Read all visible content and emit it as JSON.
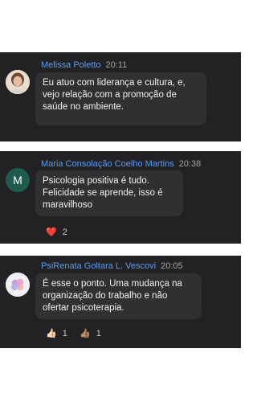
{
  "messages": [
    {
      "sender": "Melissa Poletto",
      "time": "20:11",
      "text": "Eu atuo com liderança e cultura, e,\nvejo relação com a promoção de\nsaúde no ambiente."
    },
    {
      "sender": "Maria Consolação Coelho Martins",
      "time": "20:38",
      "avatar_letter": "M",
      "text": "Psicologia positiva é tudo.\nFelicidade se aprende, isso é\nmaravilhoso",
      "reaction": {
        "emoji": "❤️",
        "count": "2"
      }
    },
    {
      "sender": "PsiRenata Goltara L. Vescovi",
      "time": "20:05",
      "text": "É esse o ponto. Uma mudança na\norganização do trabalho e não\nofertar psicoterapia.",
      "reactions": [
        {
          "emoji": "👍🏻",
          "count": "1"
        },
        {
          "emoji": "👍🏽",
          "count": "1"
        }
      ]
    }
  ],
  "colors": {
    "card_background": "#222224",
    "bubble_background": "#303032",
    "sender_name": "#5b9bf0",
    "timestamp": "#a3a3a6",
    "avatar_m_background": "#1f5a4f"
  }
}
